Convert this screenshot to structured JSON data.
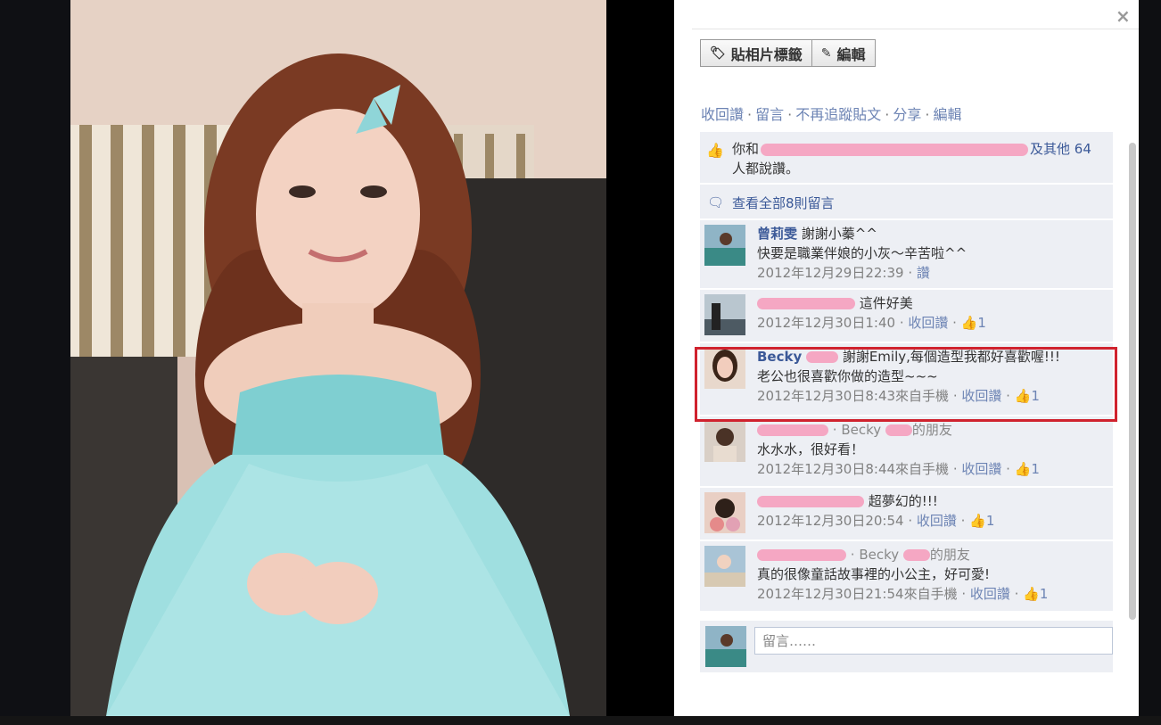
{
  "header": {
    "close_icon": "×"
  },
  "toolbar": {
    "tag_label": "貼相片標籤",
    "edit_label": "編輯"
  },
  "actions": [
    "收回讚",
    "留言",
    "不再追蹤貼文",
    "分享",
    "編輯"
  ],
  "likes": {
    "prefix": "你和",
    "more": "及其他 64",
    "suffix": "人都說讚。"
  },
  "view_all": "查看全部8則留言",
  "comments": [
    {
      "name": "曾莉雯",
      "text1": "謝謝小蓁^^",
      "text2": "快要是職業伴娘的小灰～辛苦啦^^",
      "time": "2012年12月29日22:39",
      "action": "讚",
      "likes": ""
    },
    {
      "name": "",
      "text1": "這件好美",
      "text2": "",
      "time": "2012年12月30日1:40",
      "action": "收回讚",
      "likes": "1"
    },
    {
      "name": "Becky",
      "text1": "謝謝Emily,每個造型我都好喜歡喔!!!",
      "text2": "老公也很喜歡你做的造型~~~",
      "time": "2012年12月30日8:43來自手機",
      "action": "收回讚",
      "likes": "1"
    },
    {
      "name": "",
      "friend_of": "Becky",
      "friend_suffix": "的朋友",
      "text1": "水水水，很好看！",
      "text2": "",
      "time": "2012年12月30日8:44來自手機",
      "action": "收回讚",
      "likes": "1"
    },
    {
      "name": "",
      "text1": "超夢幻的!!!",
      "text2": "",
      "time": "2012年12月30日20:54",
      "action": "收回讚",
      "likes": "1"
    },
    {
      "name": "",
      "friend_of": "Becky",
      "friend_suffix": "的朋友",
      "text1": "真的很像童話故事裡的小公主，好可愛!",
      "text2": "",
      "time": "2012年12月30日21:54來自手機",
      "action": "收回讚",
      "likes": "1"
    }
  ],
  "compose": {
    "placeholder": "留言……"
  }
}
